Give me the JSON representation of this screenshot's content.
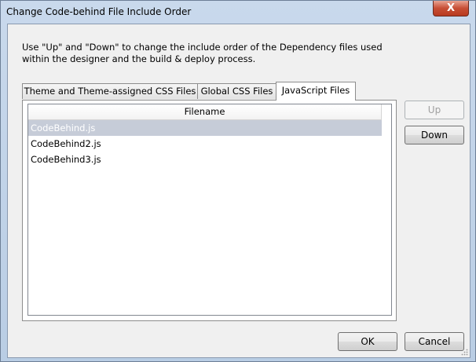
{
  "window": {
    "title": "Change Code-behind File Include Order",
    "close_glyph": "X"
  },
  "instructions": "Use \"Up\" and \"Down\" to change the include order of the Dependency files used within the designer and the build & deploy process.",
  "tabs": [
    {
      "label": "Theme and Theme-assigned CSS Files",
      "active": false
    },
    {
      "label": "Global CSS Files",
      "active": false
    },
    {
      "label": "JavaScript Files",
      "active": true
    }
  ],
  "list": {
    "column_header": "Filename",
    "rows": [
      {
        "filename": "CodeBehind.js",
        "selected": true
      },
      {
        "filename": "CodeBehind2.js",
        "selected": false
      },
      {
        "filename": "CodeBehind3.js",
        "selected": false
      }
    ]
  },
  "buttons": {
    "up": "Up",
    "down": "Down",
    "ok": "OK",
    "cancel": "Cancel"
  },
  "colors": {
    "selection": "#c6ccd8",
    "title_bar": "#c9d9ec",
    "close_button": "#c74e35"
  }
}
